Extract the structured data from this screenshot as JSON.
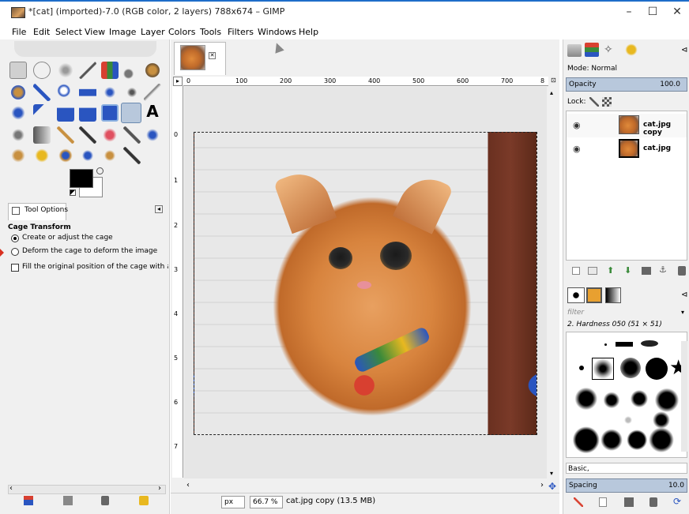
{
  "window": {
    "title": "*[cat] (imported)-7.0 (RGB color, 2 layers) 788x674 – GIMP",
    "minimize": "–",
    "maximize": "☐",
    "close": "✕"
  },
  "menu": [
    "File",
    "Edit",
    "Select",
    "View",
    "Image",
    "Layer",
    "Colors",
    "Tools",
    "Filters",
    "Windows",
    "Help"
  ],
  "tool_options": {
    "tab_label": "Tool Options",
    "tool_name": "Cage Transform",
    "option1": "Create or adjust the cage",
    "option2": "Deform the cage to deform the image",
    "fill_label": "Fill the original position of the cage with a plain c",
    "selected_option": 1
  },
  "rulers": {
    "top_ticks": [
      "0",
      "100",
      "200",
      "300",
      "400",
      "500",
      "600",
      "700",
      "8"
    ],
    "left_ticks": [
      "0",
      "1",
      "2",
      "3",
      "4",
      "5",
      "6",
      "7"
    ]
  },
  "status": {
    "unit": "px",
    "zoom": "66.7 %",
    "info": "cat.jpg copy (13.5 MB)"
  },
  "layers_panel": {
    "mode_label": "Mode: Normal",
    "opacity_label": "Opacity",
    "opacity_value": "100.0",
    "lock_label": "Lock:",
    "layers": [
      {
        "name": "cat.jpg copy",
        "visible": true,
        "selected": true
      },
      {
        "name": "cat.jpg",
        "visible": true,
        "selected": false
      }
    ]
  },
  "brushes_panel": {
    "filter_placeholder": "filter",
    "brush_name": "2. Hardness 050 (51 × 51)",
    "preset": "Basic,",
    "spacing_label": "Spacing",
    "spacing_value": "10.0"
  },
  "colors": {
    "title_accent": "#1e6dc9",
    "foreground": "#000000",
    "background": "#ffffff",
    "selection_blue": "#b8c8dc"
  }
}
